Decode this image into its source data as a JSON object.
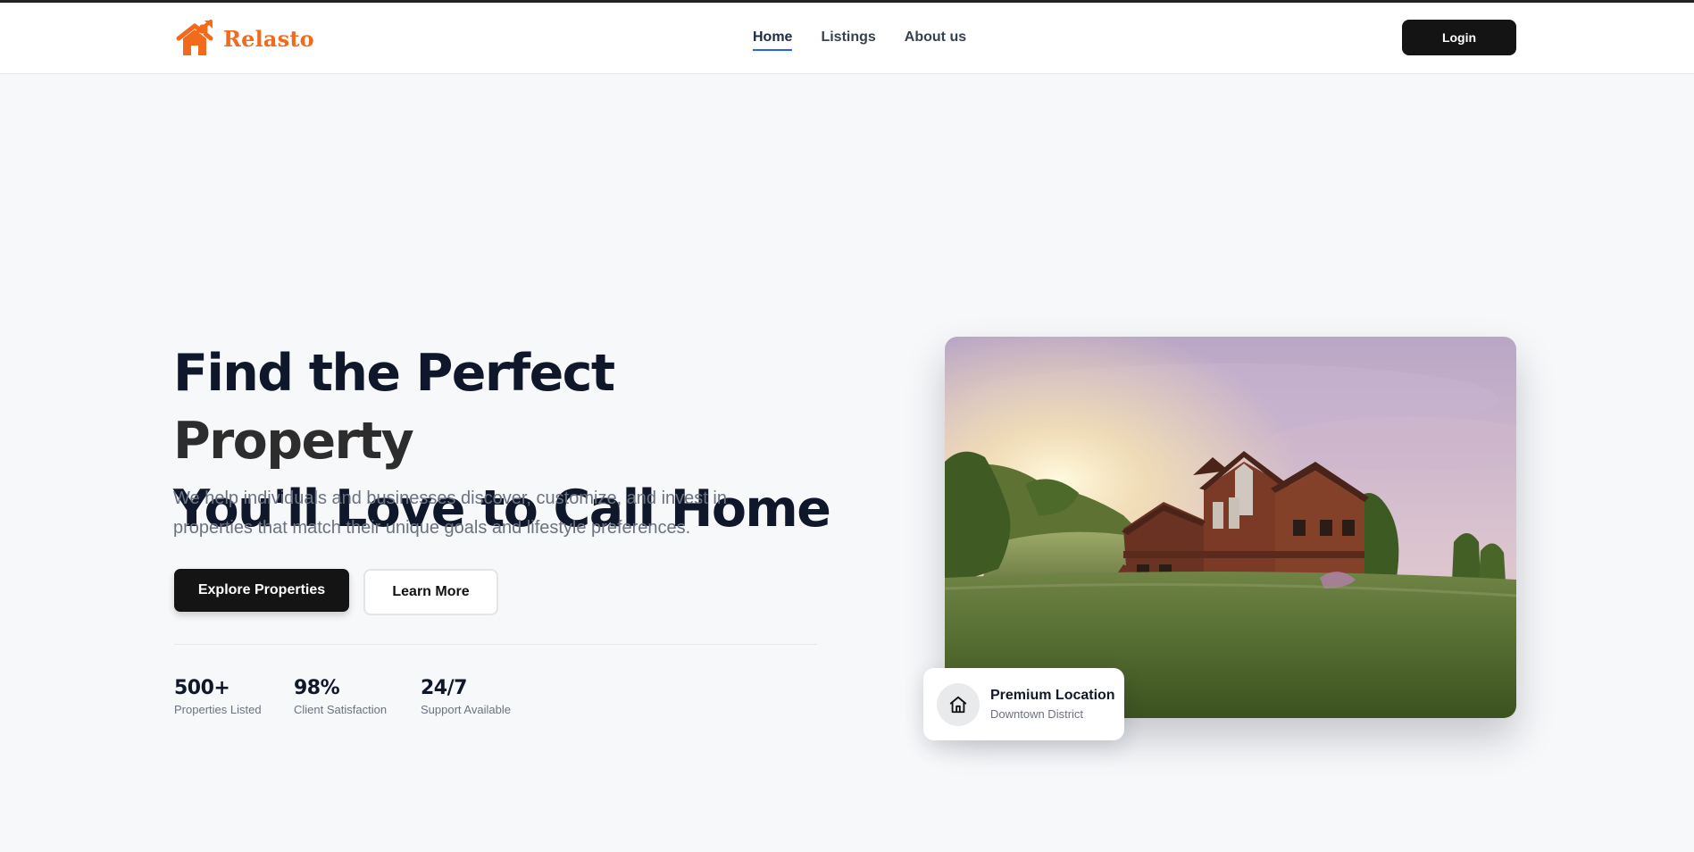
{
  "brand": {
    "name": "Relasto",
    "color": "#f26a1b",
    "logo_icon": "house-growth-icon"
  },
  "nav": {
    "items": [
      {
        "label": "Home",
        "active": true
      },
      {
        "label": "Listings",
        "active": false
      },
      {
        "label": "About us",
        "active": false
      }
    ],
    "login_label": "Login"
  },
  "hero": {
    "title_line1_a": "Find the Perfect ",
    "title_line1_b": "Property",
    "title_line2": "You'll Love to Call Home",
    "description": "We help individuals and businesses discover, customize, and invest in properties that match their unique goals and lifestyle preferences.",
    "primary_button": "Explore Properties",
    "secondary_button": "Learn More"
  },
  "stats": [
    {
      "value": "500+",
      "label": "Properties Listed"
    },
    {
      "value": "98%",
      "label": "Client Satisfaction"
    },
    {
      "value": "24/7",
      "label": "Support Available"
    }
  ],
  "feature_image": {
    "subject": "wooden country house on a green lawn at sunset"
  },
  "location_badge": {
    "icon": "home-icon",
    "title": "Premium Location",
    "subtitle": "Downtown District"
  },
  "colors": {
    "dark_button": "#141414",
    "nav_underline": "#2563eb",
    "heading": "#0f172a"
  }
}
